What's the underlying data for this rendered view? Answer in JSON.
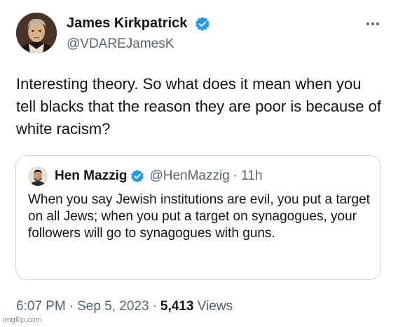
{
  "tweet": {
    "author": {
      "name": "James Kirkpatrick",
      "handle": "@VDAREJamesK",
      "avatar_icon": "portrait-painting-avatar",
      "verified_icon": "verified-badge-icon"
    },
    "more_icon": "more-options-icon",
    "text": "Interesting theory. So what does it mean when you tell blacks that the reason they are poor is because of white racism?",
    "quote": {
      "author_name": "Hen Mazzig",
      "author_handle": "@HenMazzig",
      "separator": "·",
      "time": "11h",
      "avatar_icon": "user-photo-avatar",
      "verified_icon": "verified-badge-icon",
      "text": "When you say Jewish institutions are evil, you put a target on all Jews; when you put a target on synagogues, your followers will go to synagogues with guns."
    },
    "meta": {
      "time": "6:07 PM",
      "separator": "·",
      "date": "Sep 5, 2023",
      "views_count": "5,413",
      "views_label": "Views"
    }
  },
  "watermark": "imgflip.com",
  "colors": {
    "text_primary": "#0f1419",
    "text_secondary": "#536471",
    "verified_blue": "#1d9bf0",
    "border": "#cfd9de"
  }
}
